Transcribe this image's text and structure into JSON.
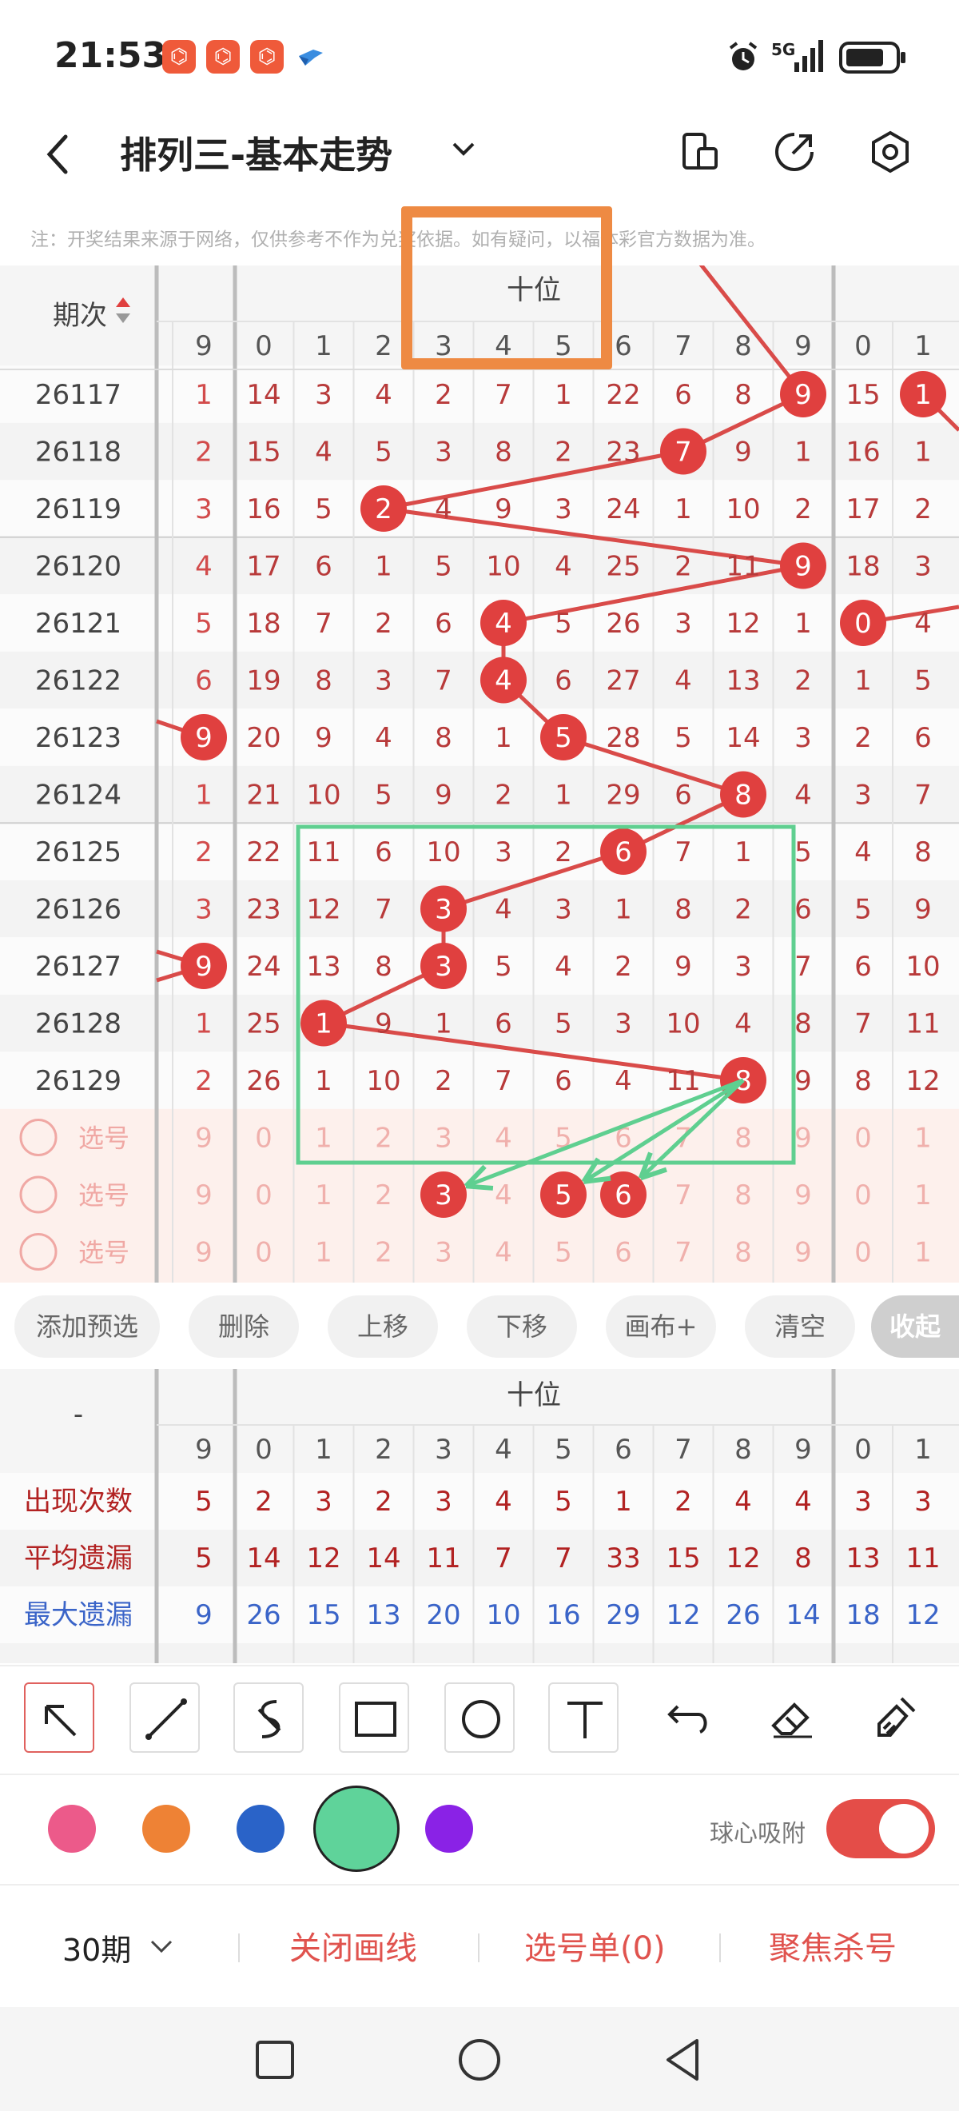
{
  "status": {
    "time": "21:53",
    "network": "5G"
  },
  "header": {
    "title": "排列三-基本走势"
  },
  "notice": "注：开奖结果来源于网络，仅供参考不作为兑奖依据。如有疑问，以福体彩官方数据为准。",
  "table": {
    "period_header": "期次",
    "group_label": "十位",
    "left_col_header": "9",
    "digit_headers": [
      "0",
      "1",
      "2",
      "3",
      "4",
      "5",
      "6",
      "7",
      "8",
      "9"
    ],
    "right_col_headers": [
      "0",
      "1"
    ],
    "rows": [
      {
        "period": "26117",
        "left": "1",
        "cells": [
          "14",
          "3",
          "4",
          "2",
          "7",
          "1",
          "22",
          "6",
          "8",
          "9"
        ],
        "ball": 9,
        "right": [
          "15",
          "1"
        ],
        "rball": 1
      },
      {
        "period": "26118",
        "left": "2",
        "cells": [
          "15",
          "4",
          "5",
          "3",
          "8",
          "2",
          "23",
          "7",
          "9",
          "1"
        ],
        "ball": 7,
        "right": [
          "16",
          "1"
        ],
        "rball": null
      },
      {
        "period": "26119",
        "left": "3",
        "cells": [
          "16",
          "5",
          "2",
          "4",
          "9",
          "3",
          "24",
          "1",
          "10",
          "2"
        ],
        "ball": 2,
        "right": [
          "17",
          "2"
        ],
        "rball": null
      },
      {
        "period": "26120",
        "left": "4",
        "cells": [
          "17",
          "6",
          "1",
          "5",
          "10",
          "4",
          "25",
          "2",
          "11",
          "9"
        ],
        "ball": 9,
        "right": [
          "18",
          "3"
        ],
        "rball": null
      },
      {
        "period": "26121",
        "left": "5",
        "cells": [
          "18",
          "7",
          "2",
          "6",
          "4",
          "5",
          "26",
          "3",
          "12",
          "1"
        ],
        "ball": 4,
        "right": [
          "0",
          "4"
        ],
        "rball": 0
      },
      {
        "period": "26122",
        "left": "6",
        "cells": [
          "19",
          "8",
          "3",
          "7",
          "4",
          "6",
          "27",
          "4",
          "13",
          "2"
        ],
        "ball": 4,
        "right": [
          "1",
          "5"
        ],
        "rball": null
      },
      {
        "period": "26123",
        "left": "9",
        "cells": [
          "20",
          "9",
          "4",
          "8",
          "1",
          "5",
          "28",
          "5",
          "14",
          "3"
        ],
        "ball": 5,
        "right": [
          "2",
          "6"
        ],
        "rball": null,
        "lball": true
      },
      {
        "period": "26124",
        "left": "1",
        "cells": [
          "21",
          "10",
          "5",
          "9",
          "2",
          "1",
          "29",
          "6",
          "8",
          "4"
        ],
        "ball": 8,
        "right": [
          "3",
          "7"
        ],
        "rball": null
      },
      {
        "period": "26125",
        "left": "2",
        "cells": [
          "22",
          "11",
          "6",
          "10",
          "3",
          "2",
          "6",
          "7",
          "1",
          "5"
        ],
        "ball": 6,
        "right": [
          "4",
          "8"
        ],
        "rball": null
      },
      {
        "period": "26126",
        "left": "3",
        "cells": [
          "23",
          "12",
          "7",
          "3",
          "4",
          "3",
          "1",
          "8",
          "2",
          "6"
        ],
        "ball": 3,
        "right": [
          "5",
          "9"
        ],
        "rball": null
      },
      {
        "period": "26127",
        "left": "9",
        "cells": [
          "24",
          "13",
          "8",
          "3",
          "5",
          "4",
          "2",
          "9",
          "3",
          "7"
        ],
        "ball": 3,
        "right": [
          "6",
          "10"
        ],
        "rball": null,
        "lball": true
      },
      {
        "period": "26128",
        "left": "1",
        "cells": [
          "25",
          "1",
          "9",
          "1",
          "6",
          "5",
          "3",
          "10",
          "4",
          "8"
        ],
        "ball": 1,
        "right": [
          "7",
          "11"
        ],
        "rball": null
      },
      {
        "period": "26129",
        "left": "2",
        "cells": [
          "26",
          "1",
          "10",
          "2",
          "7",
          "6",
          "4",
          "11",
          "8",
          "9"
        ],
        "ball": 8,
        "right": [
          "8",
          "12"
        ],
        "rball": null
      }
    ],
    "select_rows": [
      {
        "label": "选号",
        "left": "9",
        "cells": [
          "0",
          "1",
          "2",
          "3",
          "4",
          "5",
          "6",
          "7",
          "8",
          "9"
        ],
        "right": [
          "0",
          "1"
        ],
        "balls": []
      },
      {
        "label": "选号",
        "left": "9",
        "cells": [
          "0",
          "1",
          "2",
          "3",
          "4",
          "5",
          "6",
          "7",
          "8",
          "9"
        ],
        "right": [
          "0",
          "1"
        ],
        "balls": [
          3,
          5,
          6
        ]
      },
      {
        "label": "选号",
        "left": "9",
        "cells": [
          "0",
          "1",
          "2",
          "3",
          "4",
          "5",
          "6",
          "7",
          "8",
          "9"
        ],
        "right": [
          "0",
          "1"
        ],
        "balls": []
      }
    ]
  },
  "actions": [
    "添加预选",
    "删除",
    "上移",
    "下移",
    "画布+",
    "清空",
    "收起"
  ],
  "stats": {
    "corner": "-",
    "group_label": "十位",
    "left_col_header": "9",
    "digit_headers": [
      "0",
      "1",
      "2",
      "3",
      "4",
      "5",
      "6",
      "7",
      "8",
      "9"
    ],
    "right_col_headers": [
      "0",
      "1"
    ],
    "rows": [
      {
        "label": "出现次数",
        "color": "#b22222",
        "left": "5",
        "values": [
          "2",
          "3",
          "2",
          "3",
          "4",
          "5",
          "1",
          "2",
          "4",
          "4"
        ],
        "right": [
          "3",
          "3"
        ]
      },
      {
        "label": "平均遗漏",
        "color": "#b22222",
        "left": "5",
        "values": [
          "14",
          "12",
          "14",
          "11",
          "7",
          "7",
          "33",
          "15",
          "12",
          "8"
        ],
        "right": [
          "13",
          "11"
        ]
      },
      {
        "label": "最大遗漏",
        "color": "#3a64c8",
        "left": "9",
        "values": [
          "26",
          "15",
          "13",
          "20",
          "10",
          "16",
          "29",
          "12",
          "26",
          "14"
        ],
        "right": [
          "18",
          "12"
        ]
      }
    ]
  },
  "tools": [
    "arrow-tool",
    "line-tool",
    "curve-tool",
    "rectangle-tool",
    "circle-tool",
    "text-tool",
    "undo-tool",
    "eraser-tool",
    "clear-brush-tool"
  ],
  "palette": [
    "#ec5a8a",
    "#ee8235",
    "#2a63c8",
    "#5fd39a",
    "#8a22e6"
  ],
  "selected_color": "#5fd39a",
  "snap_label": "球心吸附",
  "snap_on": true,
  "footer": {
    "period": "30期",
    "close_lines": "关闭画线",
    "pick_list": "选号单(0)",
    "focus_kill": "聚焦杀号"
  },
  "colors": {
    "ball": "#e0403f",
    "line": "#d94b49",
    "cell_text": "#b83a3a",
    "green": "#5fcf90",
    "orange": "#ee8a43"
  }
}
